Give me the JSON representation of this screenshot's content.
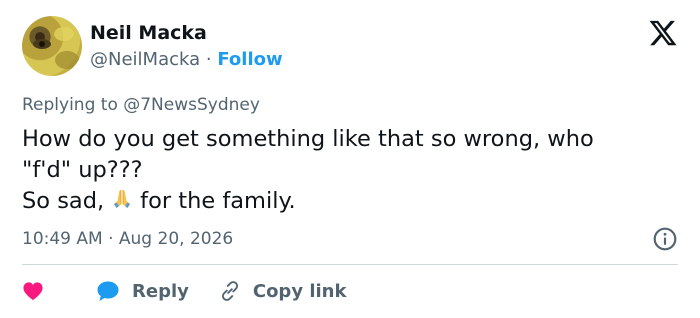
{
  "author": {
    "name": "Neil Macka",
    "handle": "@NeilMacka",
    "separator": "·",
    "follow_label": "Follow"
  },
  "brand": {
    "icon": "x-logo-icon"
  },
  "replying_to": "Replying to @7NewsSydney",
  "tweet": {
    "line1": "How do you get something like that so wrong, who",
    "line2": "\"f'd\" up???",
    "line3_before": "So sad,",
    "line3_emoji": "folded-hands-emoji",
    "line3_after": "for the family."
  },
  "timestamp": "10:49 AM · Aug 20, 2026",
  "actions": {
    "like_icon": "heart-icon",
    "reply_label": "Reply",
    "copy_label": "Copy link"
  },
  "colors": {
    "accent": "#1d9bf0",
    "like": "#f91880",
    "muted": "#536471",
    "text": "#0f1419",
    "divider": "#cfd9de"
  }
}
